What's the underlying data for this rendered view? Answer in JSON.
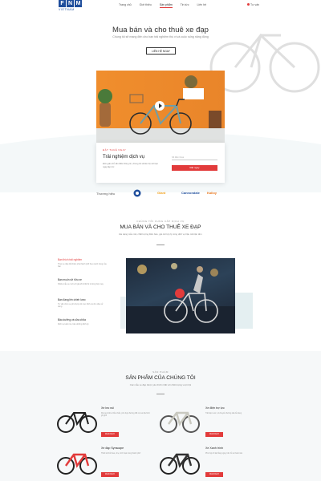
{
  "header": {
    "logo_letters": [
      "F",
      "N",
      "M"
    ],
    "logo_sub": "VIETNAM",
    "nav": [
      "Trang chủ",
      "Giới thiệu",
      "Sản phẩm",
      "Tin tức",
      "Liên hệ"
    ],
    "phone": "Tư vấn"
  },
  "hero": {
    "title": "Mua bán và cho thuê xe đạp",
    "subtitle": "Chúng tôi sẽ mang đến cho bạn trải nghiệm thú vị và cuộc sống năng động",
    "button": "LIÊN HỆ NGAY"
  },
  "service_card": {
    "kicker": "ĐẶT THUÊ NGAY",
    "title": "Trải nghiệm dịch vụ",
    "text": "Đơn giản chỉ cần điền thông tin, chúng tôi sẽ liên hệ với bạn ngay lập tức",
    "input_placeholder": "Số điện thoại",
    "button": "Đặt ngay"
  },
  "brands": {
    "label": "Thương hiệu",
    "items": [
      "Trek",
      "Giant",
      "Cannondale",
      "Kalloy"
    ]
  },
  "about": {
    "kicker": "CHÚNG TÔI CUNG CẤP DỊCH VỤ",
    "title": "MUA BÁN VÀ CHO THUÊ XE ĐẠP",
    "subtitle": "Đa dạng mẫu mã, chất lượng đảm bảo, giá cả hợp lý cùng dịch vụ hậu mãi tận tâm",
    "features": [
      {
        "title": "Bạn thích trải nghiệm",
        "desc": "Thuê xe đạp để khám phá thành phố theo cách riêng của bạn"
      },
      {
        "title": "Bạn muốn sở hữu xe",
        "desc": "Nhiều mẫu xe mới với giá tốt nhất thị trường hiện nay"
      },
      {
        "title": "Bạn đang lên chiến lược",
        "desc": "Tư vấn chọn xe phù hợp với mục đích và nhu cầu sử dụng"
      },
      {
        "title": "Bảo dưỡng và sửa chữa",
        "desc": "Dịch vụ kiểm tra, bảo dưỡng định kỳ"
      }
    ]
  },
  "products": {
    "kicker": "SẢN PHẨM",
    "title": "SẢN PHẨM CỦA CHÚNG TÔI",
    "subtitle": "Các mẫu xe đạp được yêu thích nhất với chất lượng vượt trội",
    "buy_label": "MUA NGAY",
    "items": [
      {
        "name": "Xe leo núi",
        "desc": "Khung nhôm chắc chắn, phù hợp đường đồi núi và địa hình gồ ghề"
      },
      {
        "name": "Xe điện trợ lực",
        "desc": "Tiết kiệm sức, di chuyển đường dài dễ dàng"
      },
      {
        "name": "Xe đạp Synscape",
        "desc": "Thiết kế thể thao, nhẹ, linh hoạt trong thành phố"
      },
      {
        "name": "Xe Xanh trình",
        "desc": "Phù hợp đi lại hằng ngày, bền bỉ và thoải mái"
      }
    ]
  },
  "colors": {
    "accent": "#e23b3b",
    "brand": "#1f4e9c",
    "hero_wall": "#ee8a2a"
  }
}
